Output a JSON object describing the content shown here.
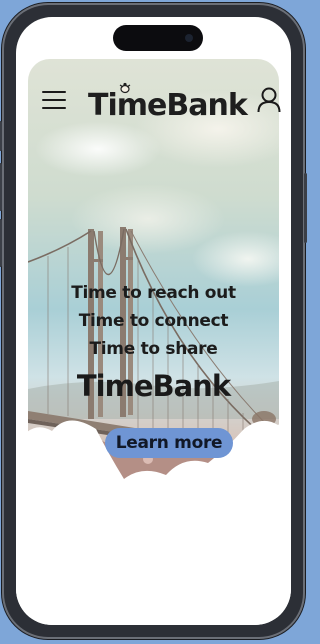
{
  "header": {
    "logo_text": "TimeBank",
    "menu_icon": "hamburger-menu-icon",
    "user_icon": "user-icon"
  },
  "hero": {
    "lines": [
      "Time to reach out",
      "Time to connect",
      "Time to share"
    ],
    "brand": "TimeBank",
    "cta_label": "Learn more"
  },
  "colors": {
    "cta_background": "#6f95d4",
    "text": "#1a1a1a",
    "device_frame": "#2c2f36",
    "page_background": "#7ea6d8"
  }
}
